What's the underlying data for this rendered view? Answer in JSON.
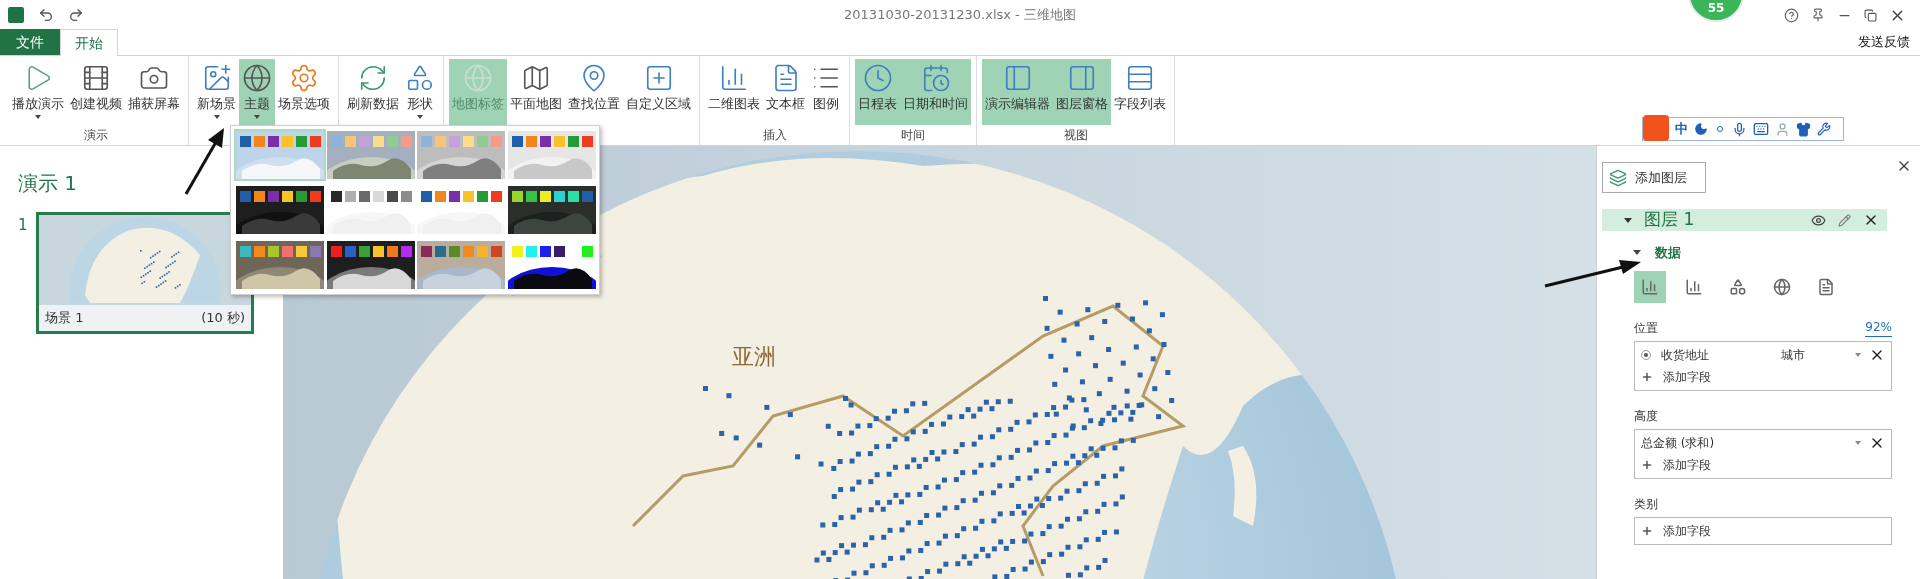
{
  "title_bar": {
    "title": "20131030-20131230.xlsx - 三维地图",
    "badge": "55"
  },
  "tabs": [
    {
      "label": "文件",
      "kind": "file",
      "selected": false
    },
    {
      "label": "开始",
      "kind": "tab",
      "selected": true
    }
  ],
  "feedback": "发送反馈",
  "ribbon": {
    "groups": [
      {
        "label": "演示",
        "buttons": [
          {
            "label": "播放演示",
            "dropdown": true,
            "selected": false,
            "disabled": false
          },
          {
            "label": "创建视频",
            "dropdown": false,
            "selected": false,
            "disabled": false
          },
          {
            "label": "捕获屏幕",
            "dropdown": false,
            "selected": false,
            "disabled": false
          }
        ]
      },
      {
        "buttons": [
          {
            "label": "新场景",
            "dropdown": true,
            "selected": false,
            "disabled": false
          },
          {
            "label": "主题",
            "dropdown": true,
            "selected": true,
            "disabled": false
          },
          {
            "label": "场景选项",
            "dropdown": false,
            "selected": false,
            "disabled": false
          }
        ]
      },
      {
        "buttons": [
          {
            "label": "刷新数据",
            "dropdown": false,
            "selected": false,
            "disabled": false
          },
          {
            "label": "形状",
            "dropdown": true,
            "selected": false,
            "disabled": false
          }
        ]
      },
      {
        "buttons": [
          {
            "label": "地图标签",
            "dropdown": false,
            "selected": true,
            "disabled": true
          },
          {
            "label": "平面地图",
            "dropdown": false,
            "selected": false,
            "disabled": false
          },
          {
            "label": "查找位置",
            "dropdown": false,
            "selected": false,
            "disabled": false
          },
          {
            "label": "自定义区域",
            "dropdown": false,
            "selected": false,
            "disabled": false
          }
        ]
      },
      {
        "label": "插入",
        "buttons": [
          {
            "label": "二维图表",
            "dropdown": false,
            "selected": false,
            "disabled": false
          },
          {
            "label": "文本框",
            "dropdown": false,
            "selected": false,
            "disabled": false
          },
          {
            "label": "图例",
            "dropdown": false,
            "selected": false,
            "disabled": false
          }
        ]
      },
      {
        "label": "时间",
        "buttons": [
          {
            "label": "日程表",
            "dropdown": false,
            "selected": true,
            "disabled": false
          },
          {
            "label": "日期和时间",
            "dropdown": false,
            "selected": true,
            "disabled": false
          }
        ]
      },
      {
        "label": "视图",
        "buttons": [
          {
            "label": "演示编辑器",
            "dropdown": false,
            "selected": true,
            "disabled": false
          },
          {
            "label": "图层窗格",
            "dropdown": false,
            "selected": true,
            "disabled": false
          },
          {
            "label": "字段列表",
            "dropdown": false,
            "selected": false,
            "disabled": false
          }
        ]
      }
    ]
  },
  "ime_toolbar": {
    "mode": "中"
  },
  "theme_gallery": [
    {
      "kind": "light",
      "selected": true,
      "swatches": [
        {
          "color": "#1f5fa8"
        },
        {
          "color": "#f0861c"
        },
        {
          "color": "#7a2fa8"
        },
        {
          "color": "#f7c22a"
        },
        {
          "color": "#259a35"
        },
        {
          "color": "#f03c1e"
        }
      ]
    },
    {
      "kind": "satellite",
      "selected": false,
      "swatches": [
        {
          "color": "#8fb2dc"
        },
        {
          "color": "#f7c47c"
        },
        {
          "color": "#c5a1dc"
        },
        {
          "color": "#fbdc8a"
        },
        {
          "color": "#8fcc8f"
        },
        {
          "color": "#f79a88"
        }
      ]
    },
    {
      "kind": "grey",
      "selected": false,
      "swatches": [
        {
          "color": "#8fb2dc"
        },
        {
          "color": "#f7c47c"
        },
        {
          "color": "#c5a1dc"
        },
        {
          "color": "#fbdc8a"
        },
        {
          "color": "#8fcc8f"
        },
        {
          "color": "#f79a88"
        }
      ]
    },
    {
      "kind": "pale",
      "selected": false,
      "swatches": [
        {
          "color": "#1f5fa8"
        },
        {
          "color": "#f0861c"
        },
        {
          "color": "#7a2fa8"
        },
        {
          "color": "#f7c22a"
        },
        {
          "color": "#259a35"
        },
        {
          "color": "#f03c1e"
        }
      ]
    },
    {
      "kind": "dark",
      "selected": false,
      "swatches": [
        {
          "color": "#1f5fa8"
        },
        {
          "color": "#f0861c"
        },
        {
          "color": "#7a2fa8"
        },
        {
          "color": "#f7c22a"
        },
        {
          "color": "#259a35"
        },
        {
          "color": "#f03c1e"
        }
      ]
    },
    {
      "kind": "white",
      "selected": false,
      "swatches": [
        {
          "color": "#2a2a2a"
        },
        {
          "color": "#b0b0b0"
        },
        {
          "color": "#6a6a6a"
        },
        {
          "color": "#d8d8d8"
        },
        {
          "color": "#4a4a4a"
        },
        {
          "color": "#8c8c8c"
        }
      ]
    },
    {
      "kind": "white",
      "selected": false,
      "swatches": [
        {
          "color": "#1f5fa8"
        },
        {
          "color": "#f0861c"
        },
        {
          "color": "#7a2fa8"
        },
        {
          "color": "#f7c22a"
        },
        {
          "color": "#259a35"
        },
        {
          "color": "#f03c1e"
        }
      ]
    },
    {
      "kind": "night",
      "selected": false,
      "swatches": [
        {
          "color": "#9ad62a"
        },
        {
          "color": "#34c24a"
        },
        {
          "color": "#eded2a"
        },
        {
          "color": "#2ad2d2"
        },
        {
          "color": "#2ae0a0"
        },
        {
          "color": "#1f5fa8"
        }
      ]
    },
    {
      "kind": "earth",
      "selected": false,
      "swatches": [
        {
          "color": "#3cb8c0"
        },
        {
          "color": "#f08a1c"
        },
        {
          "color": "#a8c82a"
        },
        {
          "color": "#f07070"
        },
        {
          "color": "#f7c83a"
        },
        {
          "color": "#8a78b0"
        }
      ]
    },
    {
      "kind": "black",
      "selected": false,
      "swatches": [
        {
          "color": "#f01e1e"
        },
        {
          "color": "#2a5fc8"
        },
        {
          "color": "#38a038"
        },
        {
          "color": "#f7c22a"
        },
        {
          "color": "#f0781e"
        },
        {
          "color": "#b42af0"
        }
      ]
    },
    {
      "kind": "tan",
      "selected": false,
      "swatches": [
        {
          "color": "#8a2a5a"
        },
        {
          "color": "#2a6a8a"
        },
        {
          "color": "#5a8a2a"
        },
        {
          "color": "#f08a1c"
        },
        {
          "color": "#f7b42a"
        },
        {
          "color": "#d0461e"
        }
      ]
    },
    {
      "kind": "blue",
      "selected": false,
      "swatches": [
        {
          "color": "#f0f01e"
        },
        {
          "color": "#1ef0f0"
        },
        {
          "color": "#1e1ef0"
        },
        {
          "color": "#3a1a6a"
        },
        {
          "color": "#ffffff"
        },
        {
          "color": "#1ef01e"
        }
      ]
    }
  ],
  "tour": {
    "title": "演示 1",
    "scenes": [
      {
        "number": "1",
        "name": "场景 1",
        "duration": "(10 秒)",
        "selected": true
      }
    ]
  },
  "map": {
    "labels": [
      "亚洲"
    ]
  },
  "layer_pane": {
    "add_layer": "添加图层",
    "layer": {
      "name": "图层 1",
      "expanded": true
    },
    "section": {
      "label": "数据",
      "expanded": true
    },
    "viz_types": [
      {
        "selected": true
      },
      {
        "selected": false
      },
      {
        "selected": false
      },
      {
        "selected": false
      },
      {
        "selected": false
      }
    ],
    "wells": [
      {
        "label": "位置",
        "percent": "92%",
        "items": [
          {
            "kind": "geo",
            "name": "收货地址",
            "type": "城市",
            "selected": true
          }
        ],
        "add": "添加字段"
      },
      {
        "label": "高度",
        "items": [
          {
            "kind": "value",
            "name": "总金额 (求和)"
          }
        ],
        "add": "添加字段"
      },
      {
        "label": "类别",
        "add": "添加字段"
      }
    ]
  }
}
